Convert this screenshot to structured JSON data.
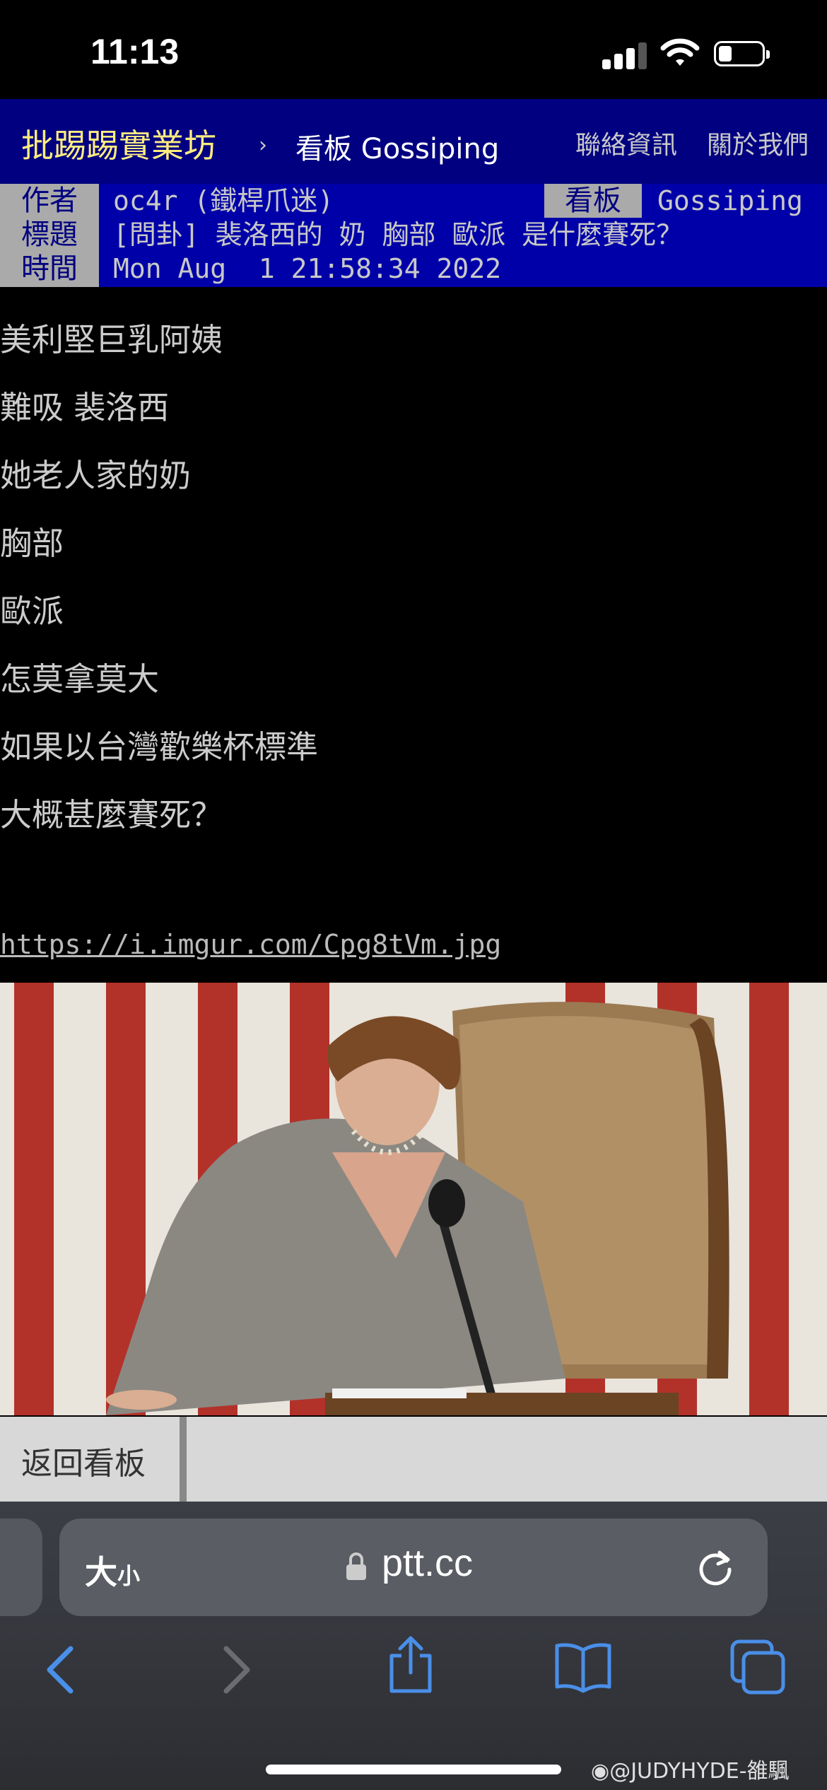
{
  "status_bar": {
    "time": "11:13"
  },
  "site_header": {
    "site_name": "批踢踢實業坊",
    "crumb_separator": "›",
    "board_crumb": "看板 Gossiping",
    "links": [
      "聯絡資訊",
      "關於我們"
    ]
  },
  "article_meta": {
    "author_label": "作者",
    "author_value": "oc4r (鐵桿爪迷)",
    "board_label": "看板",
    "board_value": "Gossiping",
    "title_label": "標題",
    "title_value": "[問卦] 裴洛西的 奶 胸部 歐派 是什麼賽死？",
    "time_label": "時間",
    "time_value": "Mon Aug  1 21:58:34 2022"
  },
  "article_body": {
    "lines": [
      "美利堅巨乳阿姨",
      "難吸 裴洛西",
      "她老人家的奶",
      "胸部",
      "歐派",
      "怎莫拿莫大",
      "如果以台灣歡樂杯標準",
      "大概甚麼賽死？"
    ],
    "link": "https://i.imgur.com/Cpg8tVm.jpg"
  },
  "back_bar": {
    "label": "返回看板"
  },
  "browser": {
    "text_size_label_big": "大",
    "text_size_label_small": "小",
    "url": "ptt.cc",
    "toolbar_icons": [
      "back-icon",
      "forward-icon",
      "share-icon",
      "bookmarks-icon",
      "tabs-icon"
    ]
  },
  "watermark": "@JUDYHYDE-雒颿",
  "colors": {
    "header_bg": "#000080",
    "meta_bg": "#0000a8",
    "meta_tag_bg": "#aaaaaa",
    "site_name": "#ffec80",
    "ios_blue": "#4a8fe8"
  }
}
